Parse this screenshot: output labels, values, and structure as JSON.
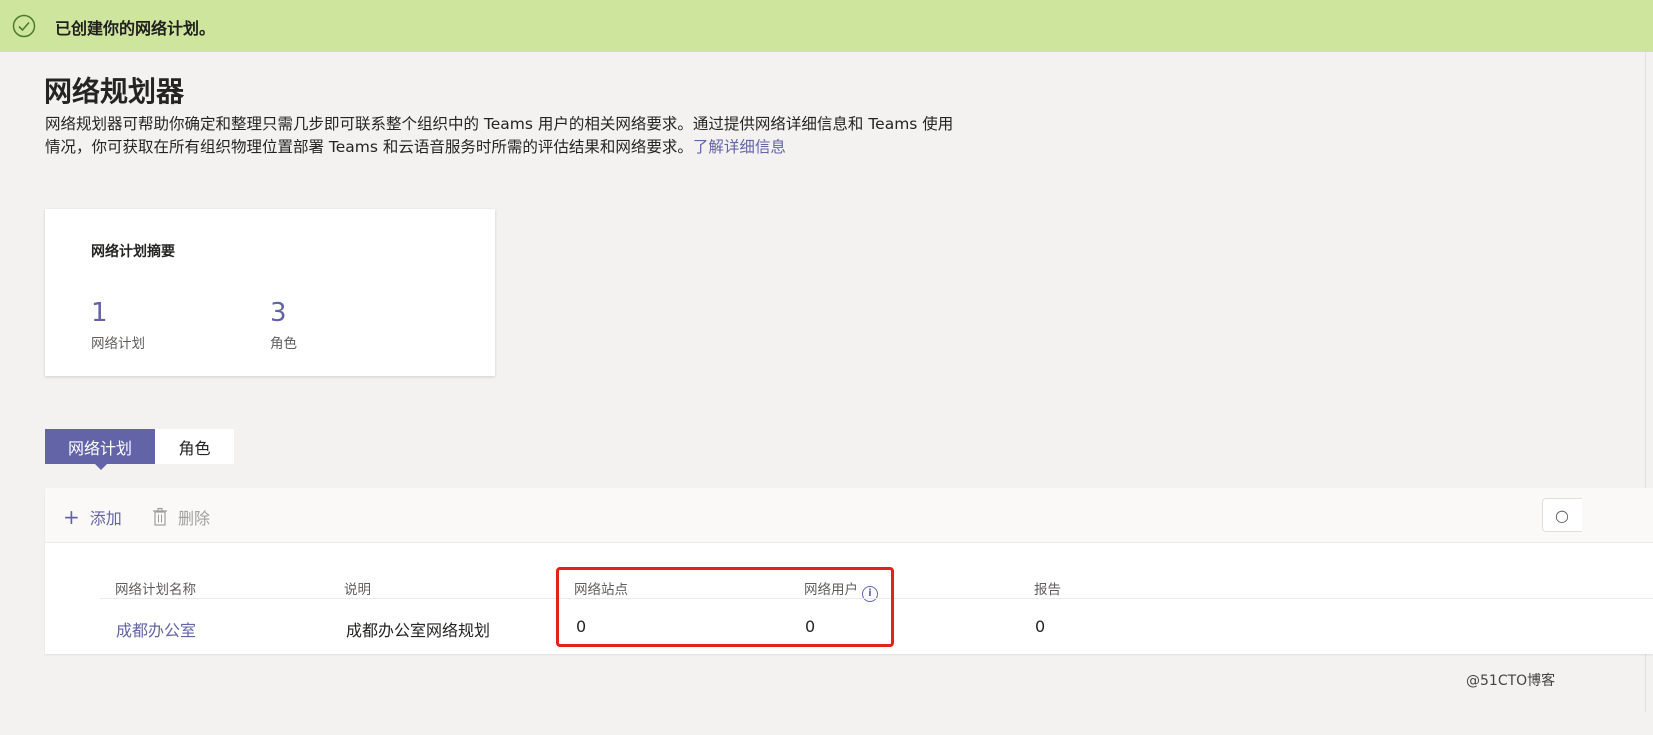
{
  "banner": {
    "message": "已创建你的网络计划。",
    "icon": "check-circle-icon",
    "color": "#cde59c"
  },
  "page": {
    "title": "网络规划器",
    "description": "网络规划器可帮助你确定和整理只需几步即可联系整个组织中的 Teams 用户的相关网络要求。通过提供网络详细信息和 Teams 使用情况，你可获取在所有组织物理位置部署 Teams 和云语音服务时所需的评估结果和网络要求。",
    "learn_more": "了解详细信息"
  },
  "summary": {
    "title": "网络计划摘要",
    "stats": [
      {
        "value": "1",
        "label": "网络计划"
      },
      {
        "value": "3",
        "label": "角色"
      }
    ]
  },
  "tabs": [
    {
      "label": "网络计划",
      "active": true
    },
    {
      "label": "角色",
      "active": false
    }
  ],
  "toolbar": {
    "add_label": "添加",
    "add_icon": "plus-icon",
    "delete_label": "删除",
    "delete_icon": "trash-icon",
    "search_icon": "search-icon"
  },
  "table": {
    "columns": [
      "网络计划名称",
      "说明",
      "网络站点",
      "网络用户",
      "报告"
    ],
    "rows": [
      {
        "name": "成都办公室",
        "description": "成都办公室网络规划",
        "sites": "0",
        "users": "0",
        "reports": "0"
      }
    ]
  },
  "accent_color": "#6264a7",
  "highlight_color": "#e3221b",
  "watermark": "@51CTO博客"
}
